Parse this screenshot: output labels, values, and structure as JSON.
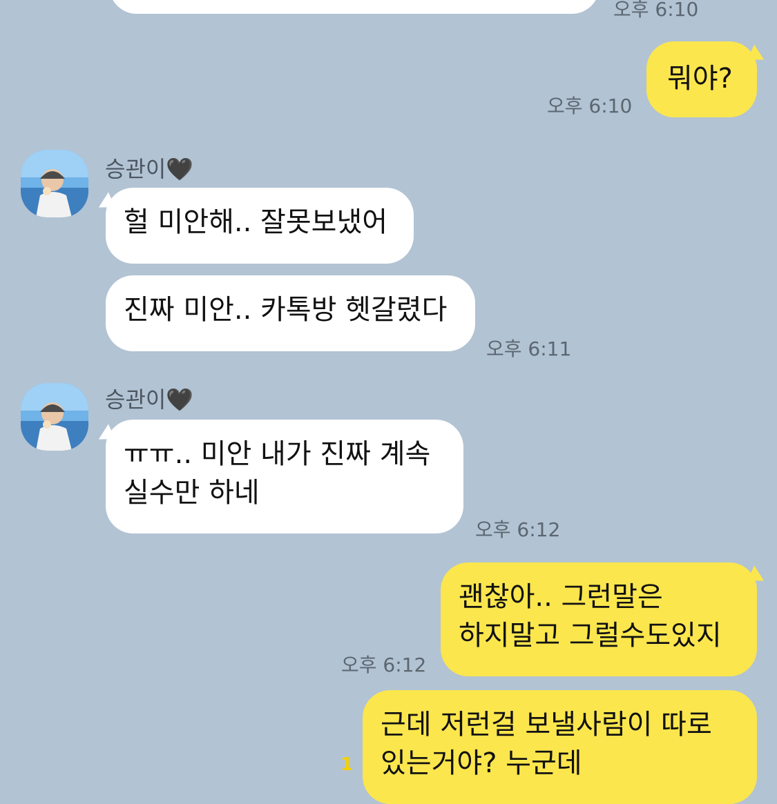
{
  "colors": {
    "background": "#b2c3d3",
    "incoming_bubble": "#ffffff",
    "outgoing_bubble": "#fbe64d",
    "unread": "#f5d000"
  },
  "messages": {
    "top_time": "오후 6:10",
    "m1": {
      "text": "뭐야?",
      "time": "오후 6:10"
    },
    "group1": {
      "name": "승관이🖤",
      "avatar_icon": "profile-photo",
      "b1": "헐 미안해.. 잘못보냈어",
      "b2": "진짜 미안.. 카톡방 헷갈렸다",
      "time": "오후 6:11"
    },
    "group2": {
      "name": "승관이🖤",
      "avatar_icon": "profile-photo",
      "line1": "ㅠㅠ.. 미안 내가 진짜 계속",
      "line2": "실수만 하네",
      "time": "오후 6:12"
    },
    "m2": {
      "line1": "괜찮아.. 그런말은",
      "line2": "하지말고 그럴수도있지",
      "time": "오후 6:12"
    },
    "m3": {
      "line1": "근데 저런걸 보낼사람이 따로",
      "line2": "있는거야? 누군데",
      "unread": "1"
    }
  }
}
